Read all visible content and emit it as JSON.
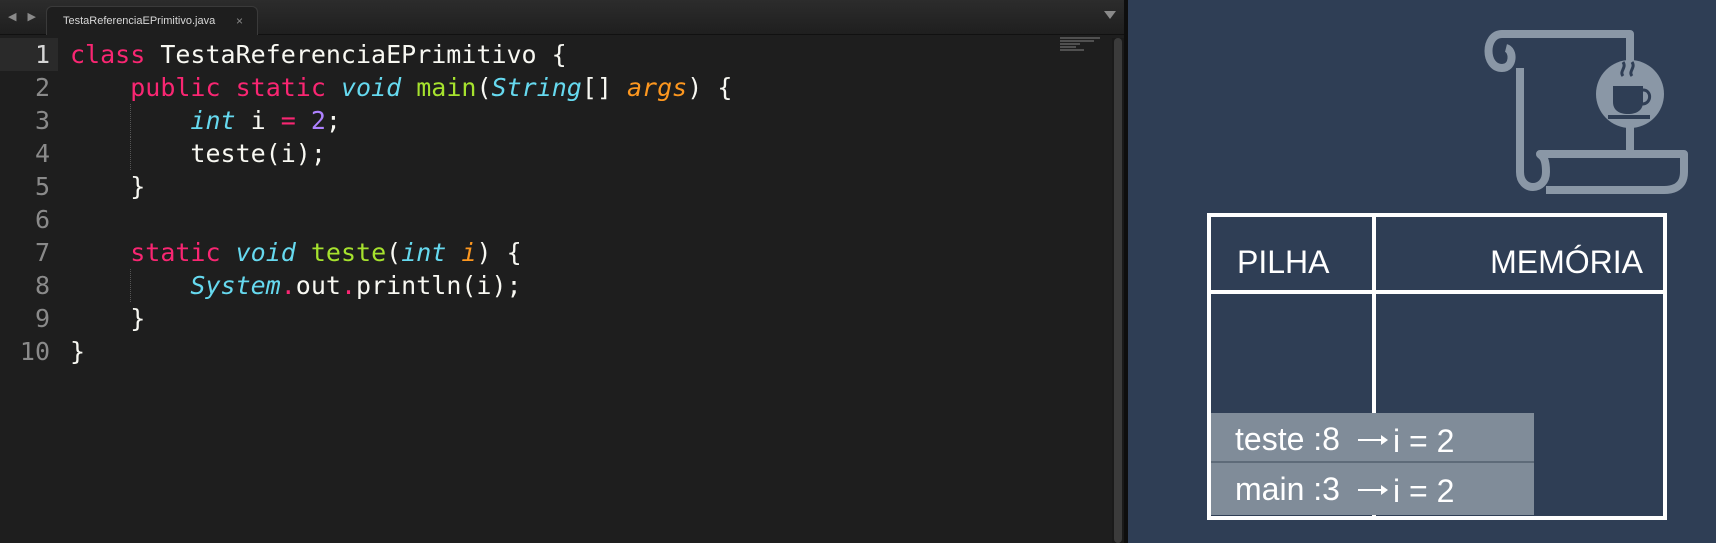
{
  "tab": {
    "title": "TestaReferenciaEPrimitivo.java",
    "close": "×"
  },
  "nav": {
    "arrows": "◀ ▶"
  },
  "gutter": [
    "1",
    "2",
    "3",
    "4",
    "5",
    "6",
    "7",
    "8",
    "9",
    "10"
  ],
  "code": {
    "l1": {
      "kw": "class",
      "name": " TestaReferenciaEPrimitivo {"
    },
    "l2": {
      "kw1": "public",
      "kw2": "static",
      "ty": "void",
      "fn": "main",
      "p1": "(",
      "ty2": "String",
      "p2": "[] ",
      "pa": "args",
      "p3": ") {"
    },
    "l3": {
      "ty": "int",
      "v": " i ",
      "op": "=",
      "sp": " ",
      "nu": "2",
      "end": ";"
    },
    "l4": {
      "text": "teste(i);"
    },
    "l5": {
      "text": "}"
    },
    "l7": {
      "kw": "static",
      "ty": "void",
      "fn": "teste",
      "p1": "(",
      "ty2": "int",
      "pa": "i",
      "p2": ") {"
    },
    "l8": {
      "ty": "System",
      "dot1": ".",
      "m1": "out",
      "dot2": ".",
      "m2": "println(i);"
    },
    "l9": {
      "text": "}"
    },
    "l10": {
      "text": "}"
    }
  },
  "slide": {
    "headers": {
      "stack": "PILHA",
      "memory": "MEMÓRIA"
    },
    "frames": [
      {
        "name": "teste :8",
        "var": "i = 2"
      },
      {
        "name": "main :3",
        "var": "i = 2"
      }
    ]
  },
  "colors": {
    "keyword": "#f92672",
    "type": "#66d9ef",
    "function": "#a6e22e",
    "param": "#fd971f",
    "number": "#ae81ff",
    "slide_bg": "#2f3e55"
  },
  "icons": {
    "logo": "java-scroll-icon"
  }
}
